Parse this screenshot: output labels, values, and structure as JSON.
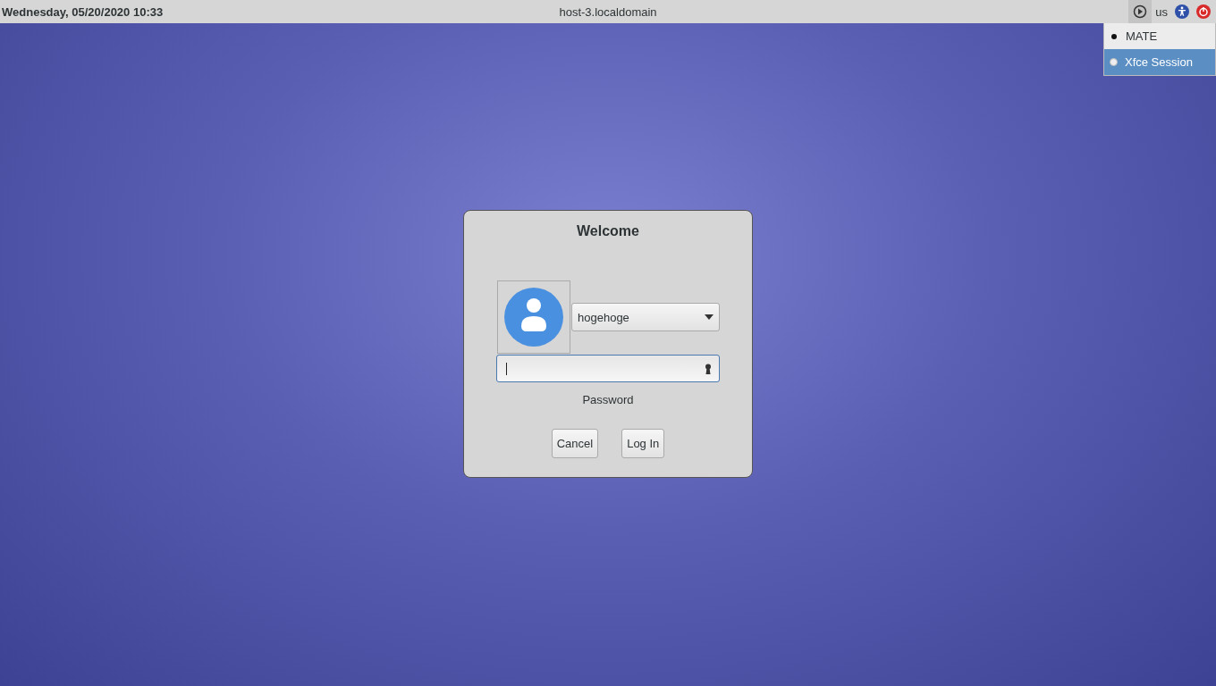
{
  "top_panel": {
    "clock": "Wednesday, 05/20/2020 10:33",
    "hostname": "host-3.localdomain",
    "keyboard_layout": "us"
  },
  "session_menu": [
    {
      "label": "MATE",
      "selected": true,
      "highlighted": false
    },
    {
      "label": "Xfce Session",
      "selected": false,
      "highlighted": true
    }
  ],
  "login_dialog": {
    "title": "Welcome",
    "user": "hogehoge",
    "password_label": "Password",
    "buttons": [
      "Cancel",
      "Log In"
    ]
  }
}
